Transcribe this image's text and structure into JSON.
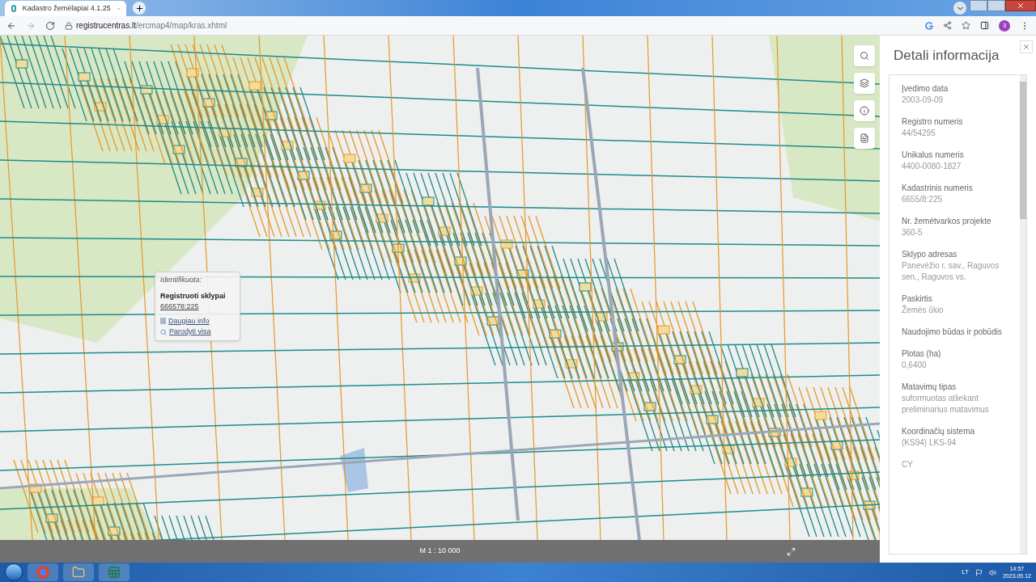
{
  "browser": {
    "tab_title": "Kadastro žemėlapiai 4.1.25",
    "url_host": "registrucentras.lt",
    "url_path": "/ercmap4/map/kras.xhtml",
    "profile": "3"
  },
  "map": {
    "scale": "M 1 : 10 000"
  },
  "popup": {
    "title": "Identifikuota:",
    "heading": "Registruoti sklypai",
    "link": "666578:225",
    "actions": [
      {
        "kind": "info",
        "label": "Daugiau info"
      },
      {
        "kind": "zoom",
        "label": "Parodyti visa"
      }
    ]
  },
  "tools": [
    {
      "kind": "search"
    },
    {
      "kind": "layers"
    },
    {
      "kind": "info"
    },
    {
      "kind": "document"
    }
  ],
  "panel": {
    "title": "Detali informacija",
    "fields": [
      {
        "label": "Įvedimo data",
        "value": "2003-09-09"
      },
      {
        "label": "Registro numeris",
        "value": "44/54295"
      },
      {
        "label": "Unikalus numeris",
        "value": "4400-0080-1827"
      },
      {
        "label": "Kadastrinis numeris",
        "value": "6655/8:225"
      },
      {
        "label": "Nr. žemėtvarkos projekte",
        "value": "360-5"
      },
      {
        "label": "Sklypo adresas",
        "value": "Panevėžio r. sav., Raguvos sen., Raguvos vs."
      },
      {
        "label": "Paskirtis",
        "value": "Žemės ūkio"
      },
      {
        "label": "Naudojimo būdas ir pobūdis"
      },
      {
        "label": "Plotas (ha)",
        "value": "0,6400"
      },
      {
        "label": "Matavimų tipas",
        "value": "suformuotas atliekant preliminarius matavimus"
      },
      {
        "label": "Koordinačių sistema",
        "value": "(KS94) LKS-94"
      },
      {
        "value": "CY"
      }
    ]
  },
  "taskbar": {
    "apps": [
      {
        "kind": "chrome"
      },
      {
        "kind": "explorer"
      },
      {
        "kind": "excel"
      }
    ],
    "language": "LT",
    "time": "14:57",
    "date": "2023.05.12"
  }
}
